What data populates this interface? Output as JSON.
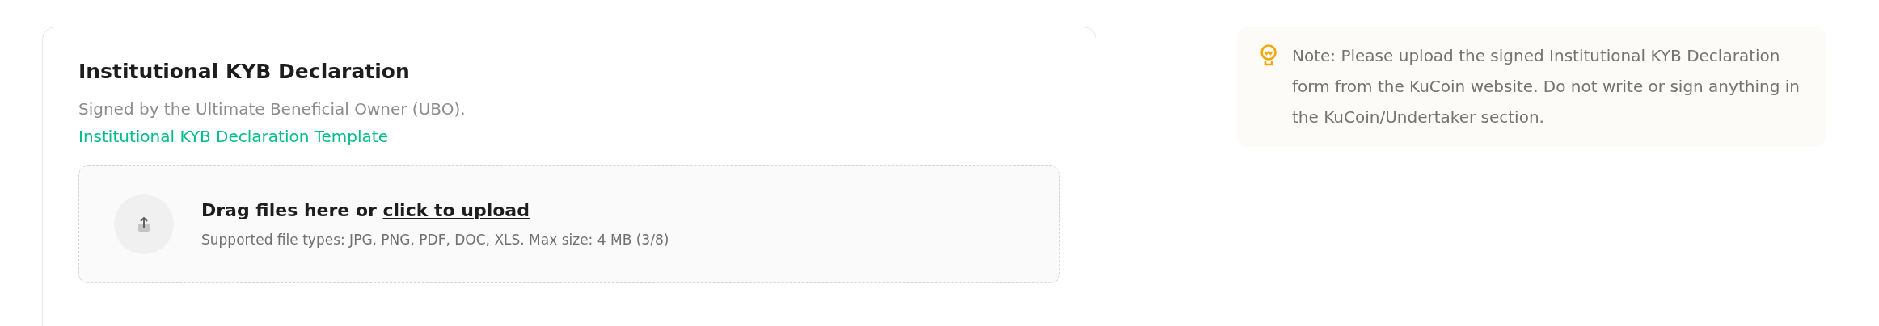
{
  "card": {
    "title": "Institutional KYB Declaration",
    "subtitle": "Signed by the Ultimate Beneficial Owner (UBO).",
    "template_link": "Institutional KYB Declaration Template",
    "upload": {
      "prompt": "Drag files here or ",
      "prompt_link": "click to upload",
      "hint": "Supported file types: JPG, PNG, PDF, DOC, XLS. Max size: 4 MB (3/8)"
    }
  },
  "note": {
    "text": "Note: Please upload the signed Institutional KYB Declaration form from the KuCoin website. Do not write or sign anything in the KuCoin/Undertaker section."
  }
}
